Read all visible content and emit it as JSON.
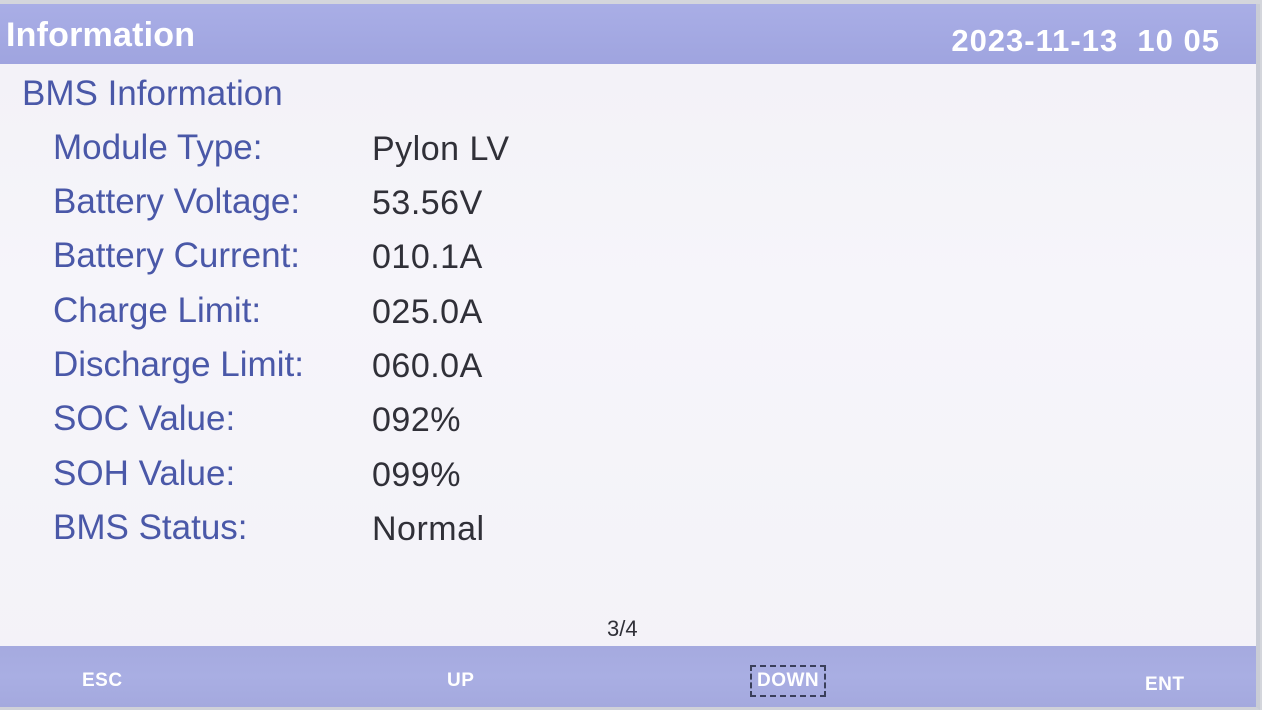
{
  "header": {
    "title": "Information",
    "datetime": "2023-11-13  10 05"
  },
  "section": {
    "title": "BMS Information"
  },
  "rows": [
    {
      "label": "Module Type:",
      "value": "Pylon LV"
    },
    {
      "label": "Battery Voltage:",
      "value": "53.56V"
    },
    {
      "label": "Battery Current:",
      "value": "010.1A"
    },
    {
      "label": "Charge Limit:",
      "value": "025.0A"
    },
    {
      "label": "Discharge Limit:",
      "value": "060.0A"
    },
    {
      "label": "SOC Value:",
      "value": "092%"
    },
    {
      "label": "SOH Value:",
      "value": "099%"
    },
    {
      "label": "BMS Status:",
      "value": "Normal"
    }
  ],
  "pager": {
    "text": "3/4"
  },
  "softkeys": {
    "esc": "ESC",
    "up": "UP",
    "down": "DOWN",
    "ent": "ENT"
  },
  "colors": {
    "bar": "#a7ace1",
    "label": "#4a58a8",
    "value": "#303038",
    "background": "#f4f3f9"
  }
}
